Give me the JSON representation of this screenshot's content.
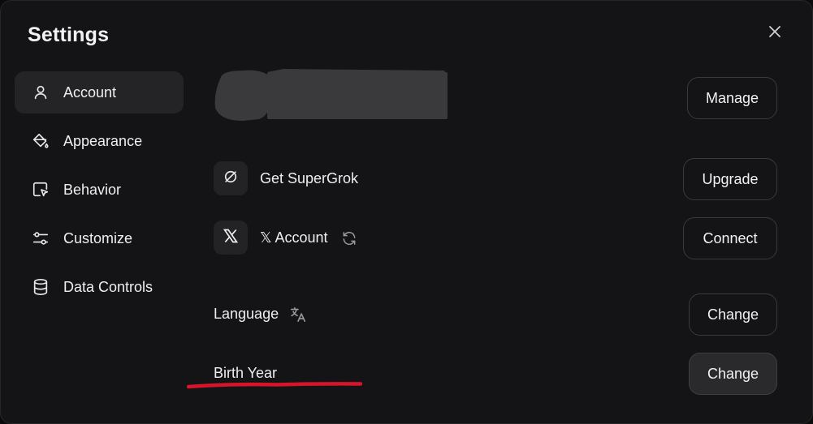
{
  "dialog": {
    "title": "Settings",
    "close_icon": "close-icon"
  },
  "sidebar": {
    "items": [
      {
        "label": "Account",
        "icon": "user-icon",
        "active": true
      },
      {
        "label": "Appearance",
        "icon": "paint-bucket-icon",
        "active": false
      },
      {
        "label": "Behavior",
        "icon": "cursor-square-icon",
        "active": false
      },
      {
        "label": "Customize",
        "icon": "sliders-icon",
        "active": false
      },
      {
        "label": "Data Controls",
        "icon": "database-icon",
        "active": false
      }
    ]
  },
  "account": {
    "profile": {
      "manage_label": "Manage"
    },
    "supergrok": {
      "label": "Get SuperGrok",
      "button_label": "Upgrade"
    },
    "x_account": {
      "label": "𝕏 Account",
      "button_label": "Connect"
    },
    "language": {
      "label": "Language",
      "button_label": "Change"
    },
    "birth_year": {
      "label": "Birth Year",
      "button_label": "Change"
    }
  },
  "colors": {
    "background": "#141416",
    "active_nav": "#242427",
    "button_border": "#3a3a3d",
    "annotation_red": "#d8142a"
  }
}
